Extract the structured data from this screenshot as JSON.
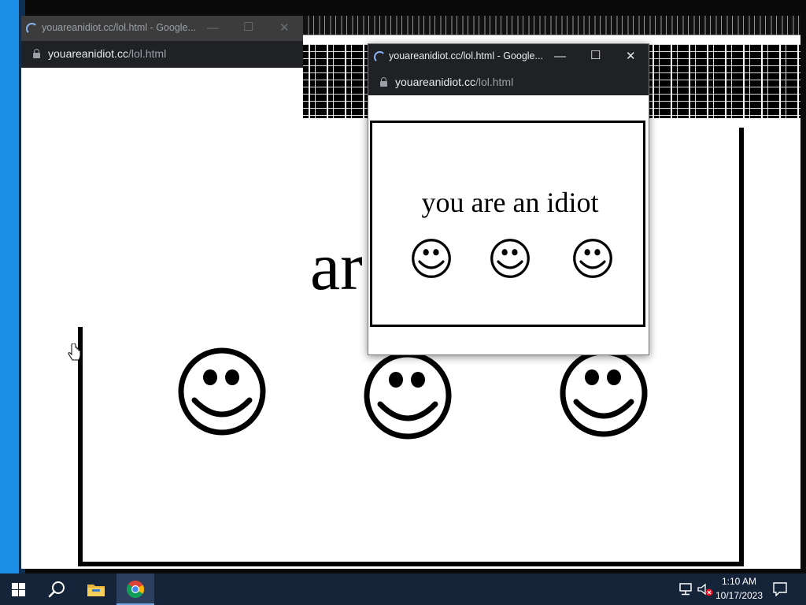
{
  "back_window": {
    "title": "youareanidiot.cc/lol.html - Google...",
    "url_host": "youareanidiot.cc",
    "url_path": "/lol.html",
    "partial_text": "ar"
  },
  "front_window": {
    "title": "youareanidiot.cc/lol.html - Google...",
    "url_host": "youareanidiot.cc",
    "url_path": "/lol.html",
    "message": "you are an idiot"
  },
  "window_controls": {
    "minimize": "—",
    "maximize": "☐",
    "close": "✕"
  },
  "taskbar": {
    "start": "windows-start",
    "search": "search",
    "apps": [
      "file-explorer",
      "google-chrome"
    ],
    "clock_time": "1:10 AM",
    "clock_date": "10/17/2023"
  },
  "colors": {
    "taskbar": "#16243a",
    "chrome_dark": "#202124",
    "accent_spinner": "#8ab4f8",
    "desktop_edge": "#1e8fe6"
  }
}
